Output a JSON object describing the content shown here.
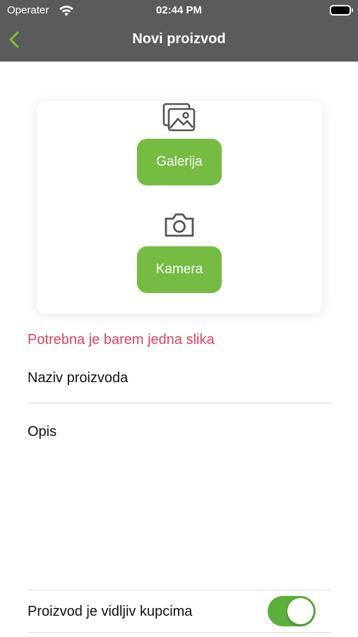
{
  "status_bar": {
    "carrier": "Operater",
    "time": "02:44 PM"
  },
  "nav": {
    "title": "Novi proizvod",
    "back_icon": "chevron-left-icon",
    "accent_color": "#76bc43"
  },
  "image_picker": {
    "gallery_icon": "gallery-icon",
    "gallery_label": "Galerija",
    "camera_icon": "camera-icon",
    "camera_label": "Kamera"
  },
  "validation": {
    "image_required": "Potrebna je barem jedna slika",
    "error_color": "#e0415e"
  },
  "form": {
    "name_placeholder": "Naziv proizvoda",
    "description_placeholder": "Opis",
    "visibility_label": "Proizvod je vidljiv kupcima",
    "visibility_on": true
  }
}
